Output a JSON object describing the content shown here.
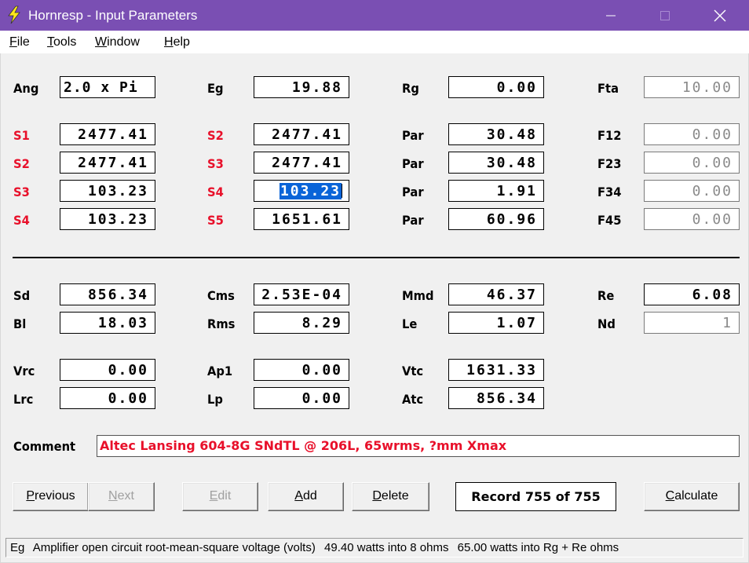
{
  "window": {
    "title": "Hornresp - Input Parameters",
    "titlebar_color": "#7a4fb3"
  },
  "menu": [
    {
      "key": "F",
      "rest": "ile"
    },
    {
      "key": "T",
      "rest": "ools"
    },
    {
      "key": "W",
      "rest": "indow"
    },
    {
      "key": "H",
      "rest": "elp"
    }
  ],
  "params": {
    "ang": {
      "label": "Ang",
      "value": "2.0 x Pi"
    },
    "eg": {
      "label": "Eg",
      "value": "19.88"
    },
    "rg": {
      "label": "Rg",
      "value": "0.00"
    },
    "fta": {
      "label": "Fta",
      "value": "10.00"
    },
    "r1c1": {
      "label": "S1",
      "value": "2477.41"
    },
    "r1c2": {
      "label": "S2",
      "value": "2477.41"
    },
    "r1c3": {
      "label": "Par",
      "value": "30.48"
    },
    "r1c4": {
      "label": "F12",
      "value": "0.00"
    },
    "r2c1": {
      "label": "S2",
      "value": "2477.41"
    },
    "r2c2": {
      "label": "S3",
      "value": "2477.41"
    },
    "r2c3": {
      "label": "Par",
      "value": "30.48"
    },
    "r2c4": {
      "label": "F23",
      "value": "0.00"
    },
    "r3c1": {
      "label": "S3",
      "value": "103.23"
    },
    "r3c2": {
      "label": "S4",
      "value": "103.23"
    },
    "r3c3": {
      "label": "Par",
      "value": "1.91"
    },
    "r3c4": {
      "label": "F34",
      "value": "0.00"
    },
    "r4c1": {
      "label": "S4",
      "value": "103.23"
    },
    "r4c2": {
      "label": "S5",
      "value": "1651.61"
    },
    "r4c3": {
      "label": "Par",
      "value": "60.96"
    },
    "r4c4": {
      "label": "F45",
      "value": "0.00"
    },
    "sd": {
      "label": "Sd",
      "value": "856.34"
    },
    "cms": {
      "label": "Cms",
      "value": "2.53E-04"
    },
    "mmd": {
      "label": "Mmd",
      "value": "46.37"
    },
    "re": {
      "label": "Re",
      "value": "6.08"
    },
    "bl": {
      "label": "Bl",
      "value": "18.03"
    },
    "rms": {
      "label": "Rms",
      "value": "8.29"
    },
    "le": {
      "label": "Le",
      "value": "1.07"
    },
    "nd": {
      "label": "Nd",
      "value": "1"
    },
    "vrc": {
      "label": "Vrc",
      "value": "0.00"
    },
    "ap1": {
      "label": "Ap1",
      "value": "0.00"
    },
    "vtc": {
      "label": "Vtc",
      "value": "1631.33"
    },
    "lrc": {
      "label": "Lrc",
      "value": "0.00"
    },
    "lp": {
      "label": "Lp",
      "value": "0.00"
    },
    "atc": {
      "label": "Atc",
      "value": "856.34"
    }
  },
  "comment": {
    "label": "Comment",
    "value": "Altec Lansing 604-8G SNdTL @ 206L, 65wrms, ?mm Xmax"
  },
  "buttons": {
    "previous": {
      "key": "P",
      "rest": "revious"
    },
    "next": {
      "key": "N",
      "rest": "ext"
    },
    "edit": {
      "key": "E",
      "rest": "dit"
    },
    "add": {
      "key": "A",
      "rest": "dd"
    },
    "delete": {
      "key": "D",
      "rest": "elete"
    },
    "calculate": {
      "key": "C",
      "rest": "alculate"
    }
  },
  "record": "Record 755 of 755",
  "status": {
    "param": "Eg",
    "description": "Amplifier open circuit root-mean-square voltage  (volts)",
    "power1": "49.40 watts into 8 ohms",
    "power2": "65.00 watts into Rg + Re ohms"
  },
  "colors": {
    "red_label": "#e8102a",
    "selection": "#0a64d8"
  }
}
